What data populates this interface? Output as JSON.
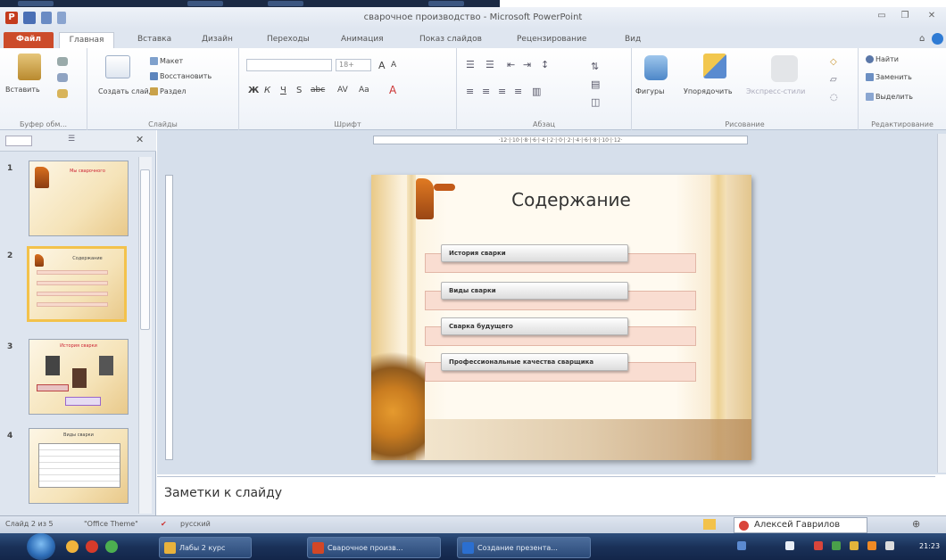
{
  "window": {
    "title": "сварочное производство - Microsoft PowerPoint",
    "app_logo": "P"
  },
  "tabs": [
    "Файл",
    "Главная",
    "Вставка",
    "Дизайн",
    "Переходы",
    "Анимация",
    "Показ слайдов",
    "Рецензирование",
    "Вид"
  ],
  "ribbon": {
    "clipboard": {
      "paste": "Вставить",
      "group": "Буфер обм..."
    },
    "slides": {
      "layout": "Макет",
      "reset": "Восстановить",
      "create": "Создать слайд",
      "section": "Раздел",
      "group": "Слайды"
    },
    "font": {
      "group": "Шрифт",
      "size": "18+"
    },
    "paragraph": {
      "group": "Абзац"
    },
    "drawing": {
      "shapes": "Фигуры",
      "arrange": "Упорядочить",
      "quick_styles": "Экспресс-стили",
      "group": "Рисование"
    },
    "editing": {
      "find": "Найти",
      "replace": "Заменить",
      "select": "Выделить",
      "group": "Редактирование"
    }
  },
  "ruler_text": "·12·|·10·|·8·|·6·|·4·|·2·|·0·|·2·|·4·|·6·|·8·|·10·|·12·",
  "thumbnails": [
    {
      "num": "1",
      "title": "Мы сварочного"
    },
    {
      "num": "2",
      "title": "Содержание",
      "selected": true
    },
    {
      "num": "3",
      "title": "История сварки"
    },
    {
      "num": "4",
      "title": "Виды сварки"
    }
  ],
  "slide": {
    "title": "Содержание",
    "items": [
      "История сварки",
      "Виды сварки",
      "Сварка будущего",
      "Профессиональные качества сварщика"
    ]
  },
  "notes_placeholder": "Заметки к слайду",
  "status": {
    "slide": "Слайд 2 из 5",
    "theme": "\"Office Theme\"",
    "lang": "русский"
  },
  "popup_user": "Алексей Гаврилов",
  "taskbar": {
    "tasks": [
      "Лабы 2 курс",
      "Сварочное произв...",
      "Создание презента..."
    ],
    "clock": "21:23"
  }
}
